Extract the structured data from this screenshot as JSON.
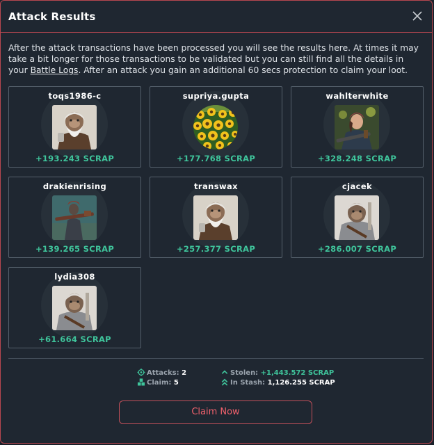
{
  "modal": {
    "title": "Attack Results",
    "description_before": "After the attack transactions have been processed you will see the results here. At times it may take a bit longer for those transactions to be validated but you can still find all the details in your ",
    "description_link": "Battle Logs",
    "description_after": ". After an attack you gain an additional 60 secs protection to claim your loot."
  },
  "results": [
    {
      "name": "toqs1986-c",
      "reward": "+193.243 SCRAP",
      "avatar": "bearded-monkey"
    },
    {
      "name": "supriya.gupta",
      "reward": "+177.768 SCRAP",
      "avatar": "sunflowers"
    },
    {
      "name": "wahlterwhite",
      "reward": "+328.248 SCRAP",
      "avatar": "soldier-girl"
    },
    {
      "name": "drakienrising",
      "reward": "+139.265 SCRAP",
      "avatar": "armored-warrior"
    },
    {
      "name": "transwax",
      "reward": "+257.377 SCRAP",
      "avatar": "bearded-monkey"
    },
    {
      "name": "cjacek",
      "reward": "+286.007 SCRAP",
      "avatar": "armored-monkey"
    },
    {
      "name": "lydia308",
      "reward": "+61.664 SCRAP",
      "avatar": "armored-monkey"
    }
  ],
  "summary": {
    "attacks_label": "Attacks:",
    "attacks_value": "2",
    "claim_label": "Claim:",
    "claim_value": "5",
    "stolen_label": "Stolen:",
    "stolen_value": "+1,443.572 SCRAP",
    "stash_label": "In Stash:",
    "stash_value": "1,126.255 SCRAP"
  },
  "actions": {
    "claim_button": "Claim Now"
  },
  "colors": {
    "accent": "#c4505a",
    "reward_green": "#3fc49b",
    "panel_bg": "#1f2731"
  }
}
